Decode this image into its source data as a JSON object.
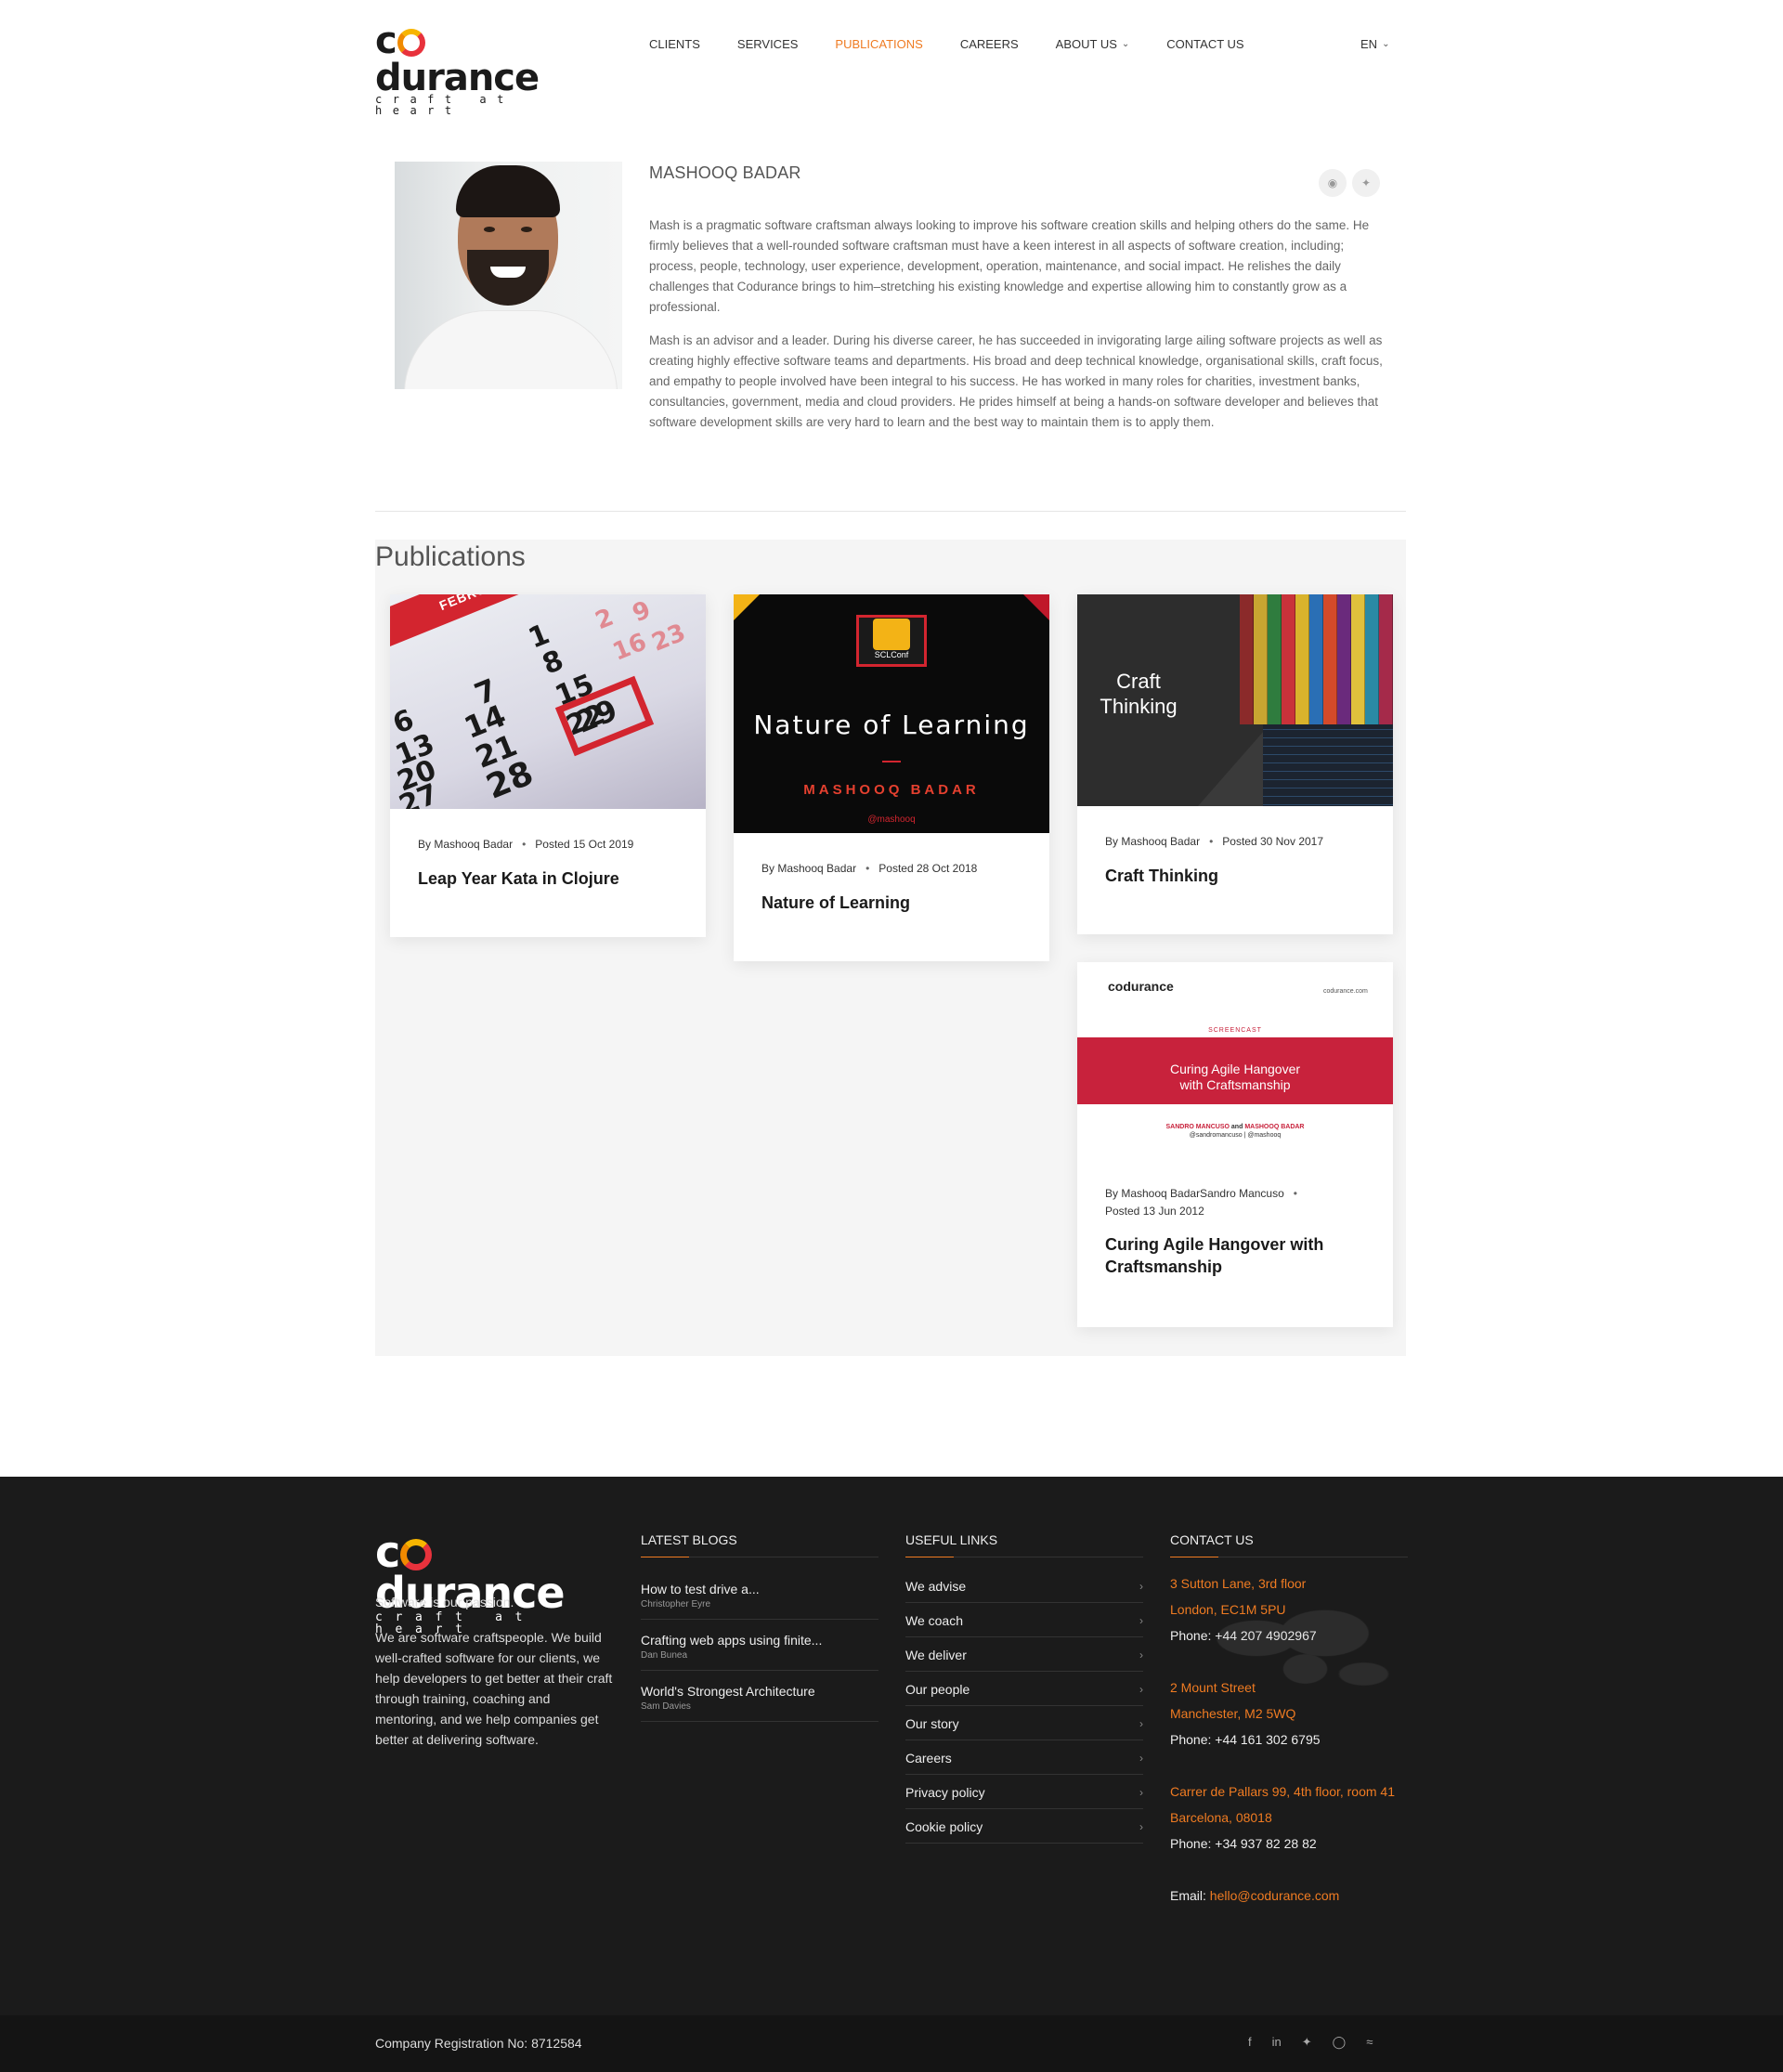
{
  "header": {
    "logo_text": "codurance",
    "logo_tagline": "craft at heart",
    "nav": [
      {
        "label": "CLIENTS",
        "active": false
      },
      {
        "label": "SERVICES",
        "active": false
      },
      {
        "label": "PUBLICATIONS",
        "active": true
      },
      {
        "label": "CAREERS",
        "active": false
      },
      {
        "label": "ABOUT US",
        "active": false,
        "dropdown": true
      },
      {
        "label": "CONTACT US",
        "active": false
      }
    ],
    "language": "EN",
    "accent_color": "#ef7b22"
  },
  "profile": {
    "name": "MASHOOQ BADAR",
    "social_icons": [
      "github-icon",
      "twitter-icon"
    ],
    "bio": [
      "Mash is a pragmatic software craftsman always looking to improve his software creation skills and helping others do the same. He firmly believes that a well-rounded software craftsman must have a keen interest in all aspects of software creation, including; process, people, technology, user experience, development, operation, maintenance, and social impact. He relishes the daily challenges that Codurance brings to him–stretching his existing knowledge and expertise allowing him to constantly grow as a professional.",
      "Mash is an advisor and a leader. During his diverse career, he has succeeded in invigorating large ailing software projects as well as creating highly effective software teams and departments. His broad and deep technical knowledge, organisational skills, craft focus, and empathy to people involved have been integral to his success. He has worked in many roles for charities, investment banks, consultancies, government, media and cloud providers. He prides himself at being a hands-on software developer and believes that software development skills are very hard to learn and the best way to maintain them is to apply them."
    ]
  },
  "publications": {
    "heading": "Publications",
    "items": [
      {
        "author": "By Mashooq Badar",
        "posted": "Posted 15 Oct 2019",
        "title": "Leap Year Kata in Clojure",
        "thumb": {
          "month": "FEBRUARY",
          "numbers": [
            "7",
            "14",
            "21",
            "28",
            "1",
            "8",
            "15",
            "22",
            "29",
            "6",
            "13",
            "20",
            "27",
            "2",
            "9",
            "16",
            "23"
          ]
        }
      },
      {
        "author": "By Mashooq Badar",
        "posted": "Posted 28 Oct 2018",
        "title": "Nature of Learning",
        "thumb": {
          "conf": "SCLConf",
          "big": "Nature of Learning",
          "who": "MASHOOQ BADAR",
          "handle": "@mashooq"
        }
      },
      {
        "author": "By Mashooq Badar",
        "posted": "Posted 30 Nov 2017",
        "title": "Craft Thinking",
        "thumb": {
          "text": "Craft Thinking"
        }
      },
      {
        "author": "By Mashooq BadarSandro Mancuso",
        "posted": "Posted 13 Jun 2012",
        "title": "Curing Agile Hangover with Craftsmanship",
        "thumb": {
          "logo": "codurance",
          "url": "codurance.com",
          "kind": "SCREENCAST",
          "headline": "Curing Agile Hangover with Craftsmanship",
          "authors_a": "SANDRO MANCUSO",
          "authors_join": " and ",
          "authors_b": "MASHOOQ BADAR",
          "handles": "@sandromancuso | @mashooq"
        }
      }
    ]
  },
  "footer": {
    "logo_text": "codurance",
    "logo_tagline": "craft at heart",
    "tagline": "Software is our passion.",
    "about": "We are software craftspeople. We build well-crafted software for our clients, we help developers to get better at their craft through training, coaching and mentoring, and we help companies get better at delivering software.",
    "blogs": {
      "heading": "LATEST BLOGS",
      "items": [
        {
          "title": "How to test drive a...",
          "author": "Christopher Eyre"
        },
        {
          "title": "Crafting web apps using finite...",
          "author": "Dan Bunea"
        },
        {
          "title": "World's Strongest Architecture",
          "author": "Sam Davies"
        }
      ]
    },
    "links": {
      "heading": "USEFUL LINKS",
      "items": [
        "We advise",
        "We coach",
        "We deliver",
        "Our people",
        "Our story",
        "Careers",
        "Privacy policy",
        "Cookie policy"
      ]
    },
    "contact": {
      "heading": "CONTACT US",
      "offices": [
        {
          "line1": "3 Sutton Lane, 3rd floor",
          "line2": "London, EC1M 5PU",
          "phone": "Phone: +44 207 4902967"
        },
        {
          "line1": "2 Mount Street",
          "line2": "Manchester, M2 5WQ",
          "phone": "Phone: +44 161 302 6795"
        },
        {
          "line1": "Carrer de Pallars 99, 4th floor, room 41",
          "line2": "Barcelona, 08018",
          "phone": "Phone: +34 937 82 28 82"
        }
      ],
      "email_label": "Email: ",
      "email": "hello@codurance.com"
    },
    "registration": "Company Registration No: 8712584",
    "social_icons": [
      "facebook-icon",
      "linkedin-icon",
      "twitter-icon",
      "instagram-icon",
      "rss-icon"
    ]
  }
}
